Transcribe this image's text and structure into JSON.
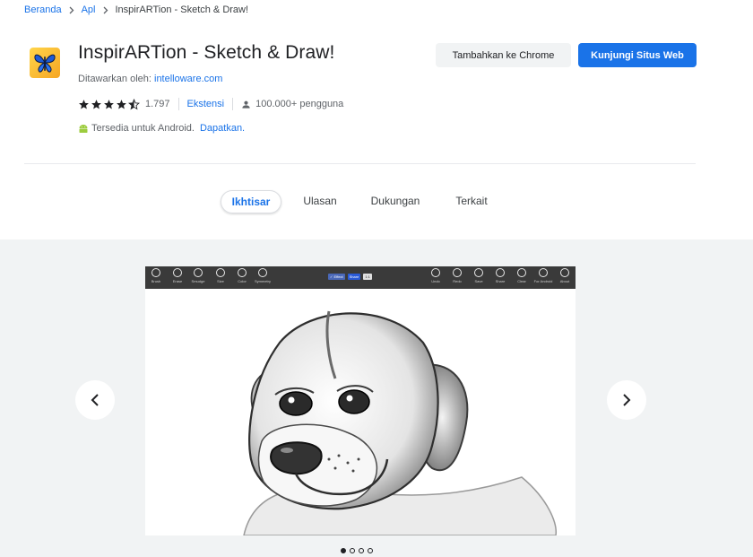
{
  "breadcrumb": {
    "home": "Beranda",
    "apps": "Apl",
    "current": "InspirARTion - Sketch & Draw!"
  },
  "extension": {
    "icon": "butterfly-icon",
    "title": "InspirARTion - Sketch & Draw!",
    "offered_by_label": "Ditawarkan oleh:",
    "developer": "intelloware.com",
    "rating": 4.5,
    "rating_count": "1.797",
    "category": "Ekstensi",
    "users": "100.000+ pengguna",
    "android_text": "Tersedia untuk Android.",
    "android_link": "Dapatkan."
  },
  "buttons": {
    "add": "Tambahkan ke Chrome",
    "visit": "Kunjungi Situs Web"
  },
  "tabs": [
    {
      "label": "Ikhtisar",
      "active": true
    },
    {
      "label": "Ulasan",
      "active": false
    },
    {
      "label": "Dukungan",
      "active": false
    },
    {
      "label": "Terkait",
      "active": false
    }
  ],
  "gallery": {
    "toolbar_left": [
      "Brush",
      "Erase",
      "Smudge",
      "Size",
      "Color",
      "Symmetry"
    ],
    "toolbar_mid": [
      "✓ Effect",
      "Share",
      "1:1"
    ],
    "toolbar_right": [
      "Undo",
      "Redo",
      "Save",
      "Share",
      "Clear",
      "For Android",
      "About"
    ],
    "slides": 4,
    "active_slide": 0
  },
  "colors": {
    "accent": "#1a73e8",
    "text": "#202124",
    "muted": "#5f6368",
    "gallery_bg": "#f1f3f4"
  }
}
